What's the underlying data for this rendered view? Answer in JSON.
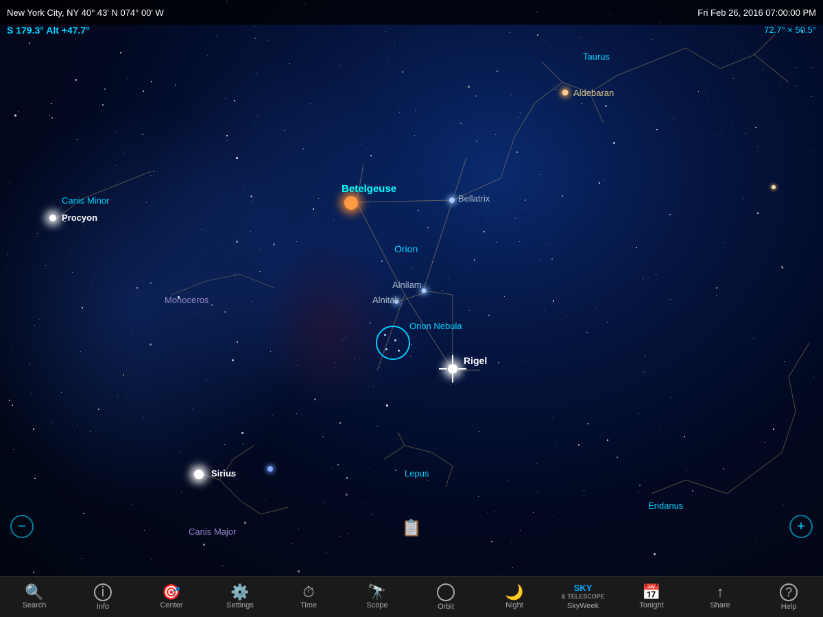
{
  "header": {
    "location": "New York City, NY  40° 43' N 074° 00' W",
    "datetime": "Fri Feb 26, 2016  07:00:00 PM"
  },
  "info": {
    "sun_azimuth": "S 179.3°  Alt +47.7°"
  },
  "view_size": "72.7° × 50.5°",
  "stars": {
    "betelgeuse": {
      "label": "Betelgeuse",
      "type": "orange_giant"
    },
    "bellatrix": {
      "label": "Bellatrix"
    },
    "rigel": {
      "label": "Rigel",
      "selected": true
    },
    "procyon": {
      "label": "Procyon"
    },
    "sirius": {
      "label": "Sirius"
    },
    "aldebaran": {
      "label": "Aldebaran"
    },
    "alnilam": {
      "label": "Alnilam"
    },
    "alnitak": {
      "label": "Alnitak"
    }
  },
  "constellations": {
    "orion": {
      "label": "Orion"
    },
    "canis_minor": {
      "label": "Canis Minor"
    },
    "canis_major": {
      "label": "Canis Major"
    },
    "monoceros": {
      "label": "Monoceros"
    },
    "taurus": {
      "label": "Taurus"
    },
    "lepus": {
      "label": "Lepus"
    },
    "eridanus": {
      "label": "Eridanus"
    }
  },
  "nebulae": {
    "orion_nebula": {
      "label": "Orion Nebula"
    }
  },
  "toolbar": {
    "items": [
      {
        "id": "search",
        "label": "Search",
        "icon": "🔍"
      },
      {
        "id": "info",
        "label": "Info",
        "icon": "ℹ"
      },
      {
        "id": "center",
        "label": "Center",
        "icon": "🎯"
      },
      {
        "id": "settings",
        "label": "Settings",
        "icon": "⚙"
      },
      {
        "id": "time",
        "label": "Time",
        "icon": "⏰"
      },
      {
        "id": "scope",
        "label": "Scope",
        "icon": "🔭"
      },
      {
        "id": "orbit",
        "label": "Orbit",
        "icon": "⭕"
      },
      {
        "id": "night",
        "label": "Night",
        "icon": "🌙"
      },
      {
        "id": "skyweek",
        "label": "SkyWeek",
        "brand": "SKY\n& TELESCOPE"
      },
      {
        "id": "tonight",
        "label": "Tonight",
        "icon": "📅"
      },
      {
        "id": "share",
        "label": "Share",
        "icon": "⬆"
      },
      {
        "id": "help",
        "label": "Help",
        "icon": "?"
      }
    ]
  },
  "zoom": {
    "minus": "−",
    "plus": "+"
  },
  "notes_icon": "📋"
}
